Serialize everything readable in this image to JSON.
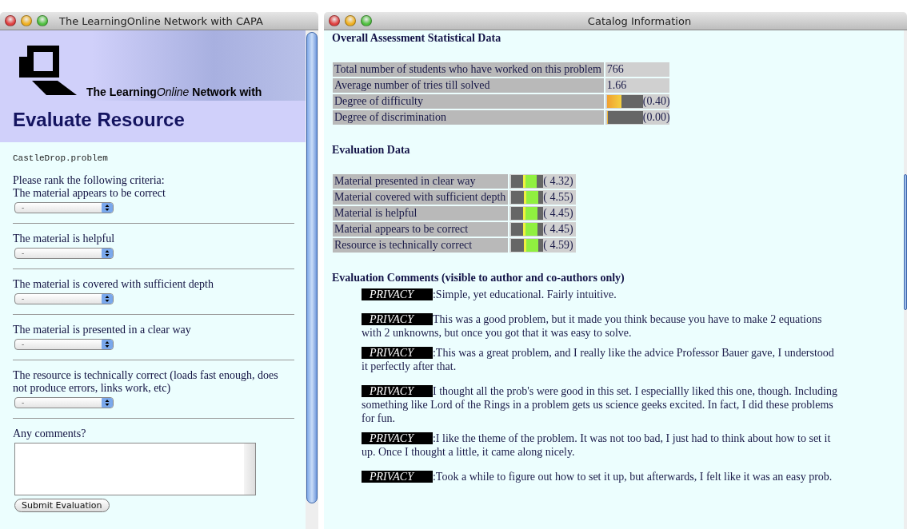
{
  "evaluate_window": {
    "title": "The LearningOnline Network with CAPA",
    "banner_text": [
      {
        "text": "The Learning",
        "italic": false
      },
      {
        "text": "Online",
        "italic": true
      },
      {
        "text": " Network with",
        "italic": false
      }
    ],
    "heading": "Evaluate Resource",
    "filename": "CastleDrop.problem",
    "intro": "Please rank the following criteria:",
    "criteria": [
      {
        "label": "The material appears to be correct",
        "value": "-"
      },
      {
        "label": "The material is helpful",
        "value": "-"
      },
      {
        "label": "The material is covered with sufficient depth",
        "value": "-"
      },
      {
        "label": "The material is presented in a clear way",
        "value": "-"
      },
      {
        "label": "The resource is technically correct (loads fast enough, does not produce errors, links work, etc)",
        "value": "-"
      }
    ],
    "comments_label": "Any comments?",
    "submit": "Submit Evaluation"
  },
  "catalog_window": {
    "title": "Catalog Information",
    "stats_heading": "Overall Assessment Statistical Data",
    "stats": [
      {
        "label": "Total number of students who have worked on this problem",
        "kind": "text",
        "value": "766"
      },
      {
        "label": "Average number of tries till solved",
        "kind": "text",
        "value": "1.66"
      },
      {
        "label": "Degree of difficulty",
        "kind": "bar",
        "level": 0.4,
        "reading": "(0.40)"
      },
      {
        "label": "Degree of discrimination",
        "kind": "bar",
        "level": 0,
        "reading": "(0.00)"
      }
    ],
    "evaluation_heading": "Evaluation Data",
    "ratings": [
      {
        "label": "Material presented in clear way",
        "level": 0.864,
        "reading": "( 4.32)"
      },
      {
        "label": "Material covered with sufficient depth",
        "level": 0.91,
        "reading": "( 4.55)"
      },
      {
        "label": "Material is helpful",
        "level": 0.89,
        "reading": "( 4.45)"
      },
      {
        "label": "Material appears to be correct",
        "level": 0.89,
        "reading": "( 4.45)"
      },
      {
        "label": "Resource is technically correct",
        "level": 0.918,
        "reading": "( 4.59)"
      }
    ],
    "comments_heading": "Evaluation Comments (visible to author and co-authors only)",
    "comments": [
      {
        "author": "PRIVACY",
        "text": ":Simple, yet educational. Fairly intuitive."
      },
      {
        "author": "PRIVACY",
        "text": "This was a good problem, but it made you think because you have to make 2 equations with 2 unknowns, but once you got that it was easy to solve."
      },
      {
        "author": "PRIVACY",
        "text": ":This was a great problem, and I really like the advice Professor Bauer gave, I understood it perfectly after that."
      },
      {
        "author": "PRIVACY",
        "text": "I thought all the prob's were good in this set. I especiallly liked this one, though. Including something like Lord of the Rings in a problem gets us science geeks excited. In fact, I did these problems for fun."
      },
      {
        "author": "PRIVACY",
        "text": ":I like the theme of the problem. It was not too bad, I just had to think about how to set it up. Once I thought a little, it came along nicely."
      },
      {
        "author": "PRIVACY",
        "text": ":Took a while to figure out how to set it up, but afterwards, I felt like it was an easy prob."
      }
    ]
  }
}
